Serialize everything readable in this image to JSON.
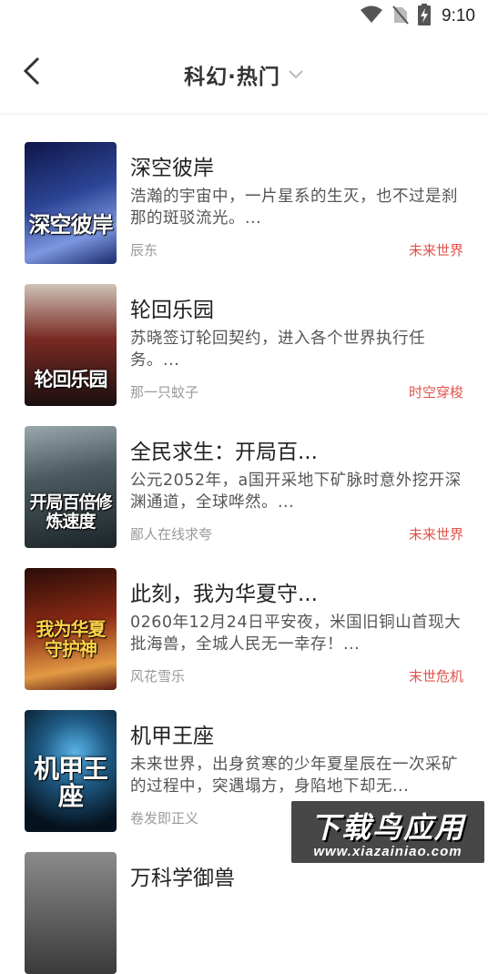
{
  "status_bar": {
    "time": "9:10",
    "icons": [
      "wifi-icon",
      "no-sim-icon",
      "battery-charging-icon"
    ]
  },
  "header": {
    "title": "科幻·热门",
    "back_icon": "chevron-left-icon",
    "dropdown_icon": "chevron-down-icon"
  },
  "books": [
    {
      "title": "深空彼岸",
      "description": "浩瀚的宇宙中，一片星系的生灭，也不过是刹那的斑驳流光。...",
      "author": "辰东",
      "tag": "未来世界",
      "cover_text": "深空彼岸",
      "cover_colors": [
        "#1b2a6b",
        "#5a74c9"
      ]
    },
    {
      "title": "轮回乐园",
      "description": "苏晓签订轮回契约，进入各个世界执行任务。...",
      "author": "那一只蚊子",
      "tag": "时空穿梭",
      "cover_text": "轮回乐园",
      "cover_colors": [
        "#2a1a1a",
        "#b8a89a"
      ]
    },
    {
      "title": "全民求生：开局百...",
      "description": "公元2052年，a国开采地下矿脉时意外挖开深渊通道，全球哗然。...",
      "author": "鄙人在线求夸",
      "tag": "未来世界",
      "cover_text": "开局百倍修炼速度",
      "cover_colors": [
        "#23323a",
        "#8aa0a6"
      ]
    },
    {
      "title": "此刻，我为华夏守...",
      "description": "0260年12月24日平安夜，米国旧铜山首现大批海兽，全城人民无一幸存！...",
      "author": "风花雪乐",
      "tag": "末世危机",
      "cover_text": "我为华夏守护神",
      "cover_colors": [
        "#5a1a12",
        "#d8873a"
      ]
    },
    {
      "title": "机甲王座",
      "description": "未来世界，出身贫寒的少年夏星辰在一次采矿的过程中，突遇塌方，身陷地下却无...",
      "author": "卷发即正义",
      "tag": "",
      "cover_text": "机甲王座",
      "cover_colors": [
        "#06131f",
        "#2f7fb0"
      ]
    },
    {
      "title": "万科学御兽",
      "description": "",
      "author": "",
      "tag": "",
      "cover_text": "",
      "cover_colors": [
        "#3a3a3a",
        "#8a8a8a"
      ]
    }
  ],
  "watermark": {
    "main": "下载鸟应用",
    "sub": "www.xiazainiao.com"
  }
}
